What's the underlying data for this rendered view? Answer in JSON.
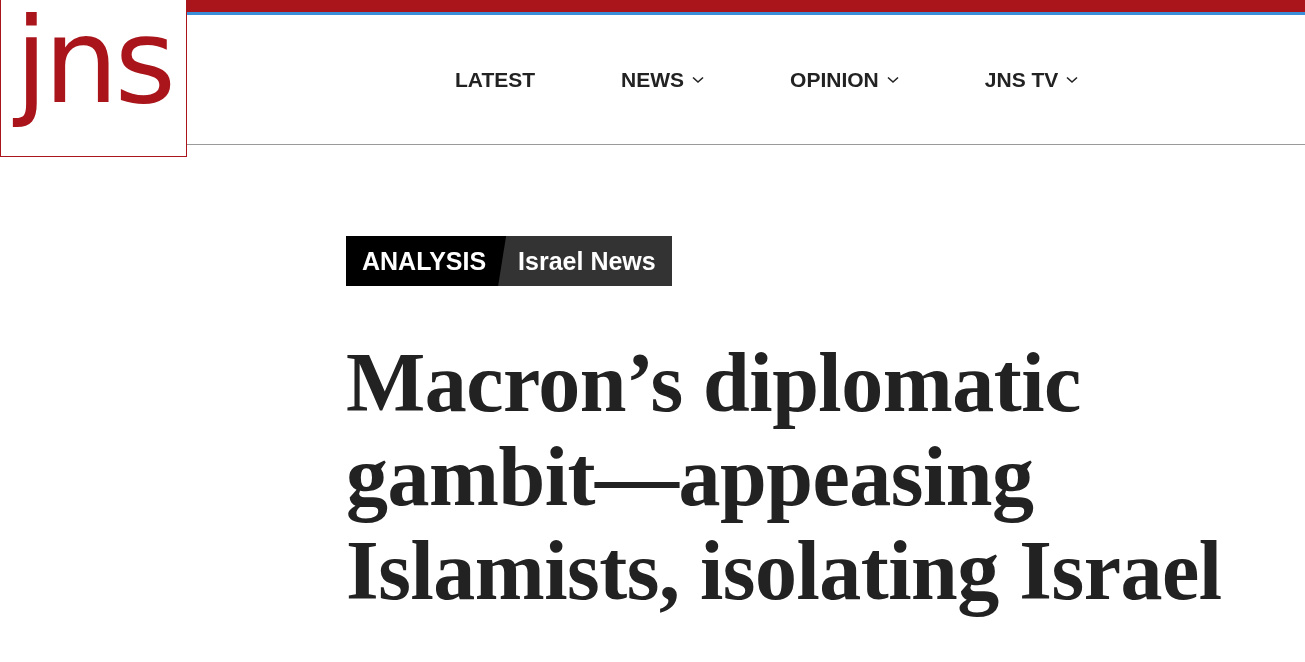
{
  "logo": "jns",
  "nav": [
    {
      "label": "LATEST",
      "dropdown": false
    },
    {
      "label": "NEWS",
      "dropdown": true
    },
    {
      "label": "OPINION",
      "dropdown": true
    },
    {
      "label": "JNS TV",
      "dropdown": true
    }
  ],
  "article": {
    "tags": [
      {
        "label": "ANALYSIS",
        "kind": "primary"
      },
      {
        "label": "Israel News",
        "kind": "secondary"
      }
    ],
    "headline": "Macron’s diplomatic gambit—appeasing Islamists, isolating Israel"
  }
}
